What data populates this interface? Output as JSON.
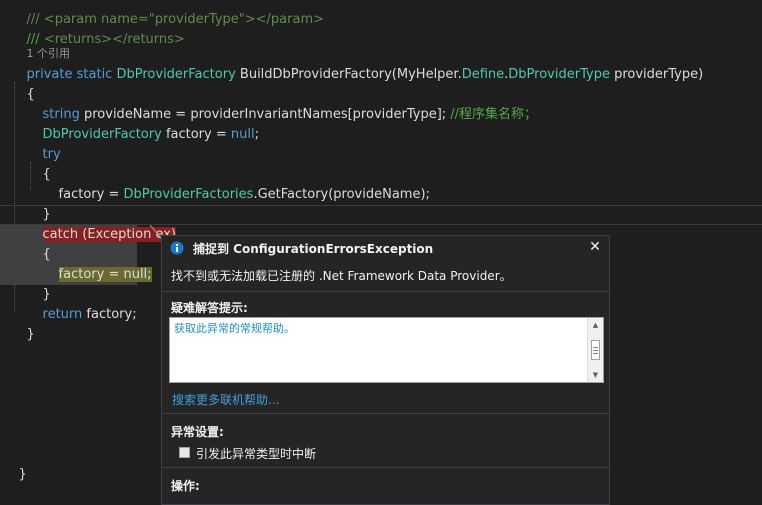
{
  "editor": {
    "lines": {
      "doc_param": "/// <param name=\"providerType\"></param>",
      "doc_returns_prefix": "/// ",
      "doc_returns_tags": "<returns></returns>",
      "codelens": "1 个引用",
      "sig_private": "private",
      "sig_static": "static",
      "sig_return_type": "DbProviderFactory",
      "sig_method": "BuildDbProviderFactory(MyHelper.",
      "sig_define": "Define",
      "sig_dot": ".",
      "sig_param_type": "DbProviderType",
      "sig_param": " providerType)",
      "brace_open": "{",
      "l1_string": "string",
      "l1_code": " provideName = providerInvariantNames[providerType];",
      "l1_comment": " //程序集名称；",
      "l2_type": "DbProviderFactory",
      "l2_code": " factory = ",
      "l2_null": "null",
      "l2_end": ";",
      "try_kw": "try",
      "try_open": "{",
      "l3_code": "factory = ",
      "l3_type": "DbProviderFactories",
      "l3_call": ".GetFactory(provideName);",
      "try_close": "}",
      "catch_text": "catch (Exception ex)",
      "catch_open": "{",
      "catch_stmt": "factory = null;",
      "catch_close": "}",
      "return_kw": "return",
      "return_code": " factory;",
      "method_close": "}",
      "class_close": "}"
    }
  },
  "popup": {
    "title": "捕捉到 ConfigurationErrorsException",
    "message": "找不到或无法加载已注册的 .Net Framework Data Provider。",
    "hints_title": "疑难解答提示:",
    "hint_link": "获取此异常的常规帮助。",
    "online_help_link": "搜索更多联机帮助...",
    "settings_title": "异常设置:",
    "break_checkbox_label": "引发此异常类型时中断",
    "break_checkbox_checked": false,
    "actions_title": "操作:",
    "close_glyph": "✕"
  },
  "colors": {
    "background": "#1e1e1e",
    "keyword": "#569cd6",
    "type": "#4ec9b0",
    "comment": "#57a64a",
    "catch_highlight": "#8a1f1f",
    "link": "#3f9fe0",
    "info_icon": "#1e78c8"
  },
  "icons": {
    "popup_icon": "info-icon",
    "close": "close-icon"
  }
}
